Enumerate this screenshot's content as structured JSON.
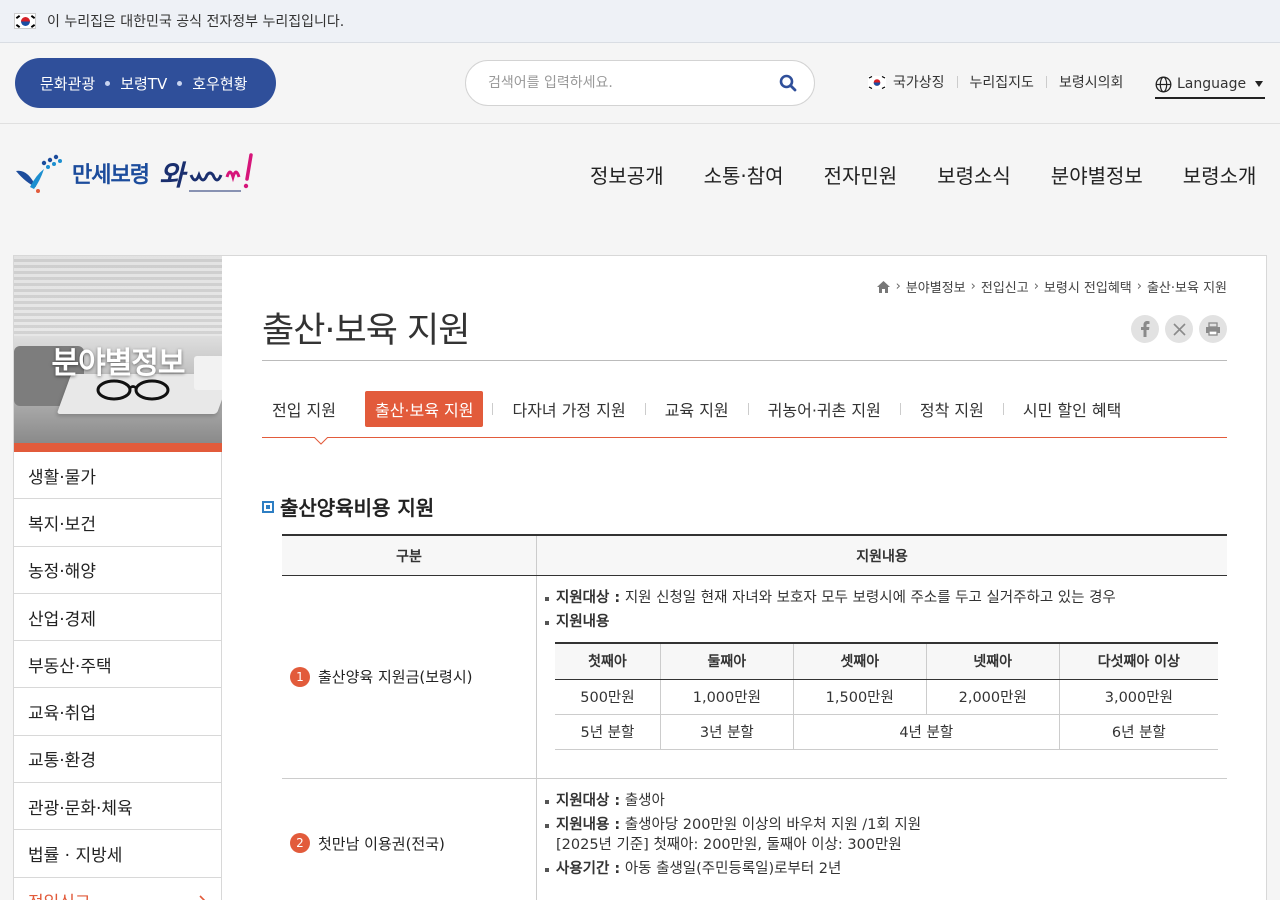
{
  "gov_banner": {
    "text": "이 누리집은 대한민국 공식 전자정부 누리집입니다."
  },
  "quick_links": [
    "문화관광",
    "보령TV",
    "호우현황"
  ],
  "search": {
    "placeholder": "검색어를 입력하세요."
  },
  "top_links": [
    "국가상징",
    "누리집지도",
    "보령시의회"
  ],
  "language": {
    "label": "Language"
  },
  "logo": {
    "city_name": "만세보령",
    "slogan": "와wow!"
  },
  "gnb": [
    "정보공개",
    "소통·참여",
    "전자민원",
    "보령소식",
    "분야별정보",
    "보령소개"
  ],
  "sidebar": {
    "title": "분야별정보",
    "items": [
      "생활·물가",
      "복지·보건",
      "농정·해양",
      "산업·경제",
      "부동산·주택",
      "교육·취업",
      "교통·환경",
      "관광·문화·체육",
      "법률 · 지방세",
      "전입신고"
    ]
  },
  "breadcrumb": [
    "분야별정보",
    "전입신고",
    "보령시 전입혜택",
    "출산·보육 지원"
  ],
  "page_title": "출산·보육 지원",
  "share": [
    "facebook-icon",
    "x-icon",
    "print-icon"
  ],
  "tabs": [
    "전입 지원",
    "출산·보육 지원",
    "다자녀 가정 지원",
    "교육 지원",
    "귀농어·귀촌 지원",
    "정착 지원",
    "시민 할인 혜택"
  ],
  "active_tab": 1,
  "section_title": "출산양육비용 지원",
  "table": {
    "headers": [
      "구분",
      "지원내용"
    ],
    "rows": [
      {
        "num": "1",
        "label": "출산양육 지원금(보령시)",
        "target_label": "지원대상 :",
        "target_text": "지원 신청일 현재 자녀와 보호자 모두 보령시에 주소를 두고 실거주하고 있는 경우",
        "content_label": "지원내용",
        "sub_headers": [
          "첫째아",
          "둘째아",
          "셋째아",
          "넷째아",
          "다섯째아 이상"
        ],
        "amounts": [
          "500만원",
          "1,000만원",
          "1,500만원",
          "2,000만원",
          "3,000만원"
        ],
        "installments": [
          "5년 분할",
          "3년 분할",
          "4년 분할",
          "6년 분할"
        ]
      },
      {
        "num": "2",
        "label": "첫만남 이용권(전국)",
        "target_label": "지원대상 :",
        "target_text": "출생아",
        "content_label": "지원내용 :",
        "content_text": "출생아당 200만원 이상의 바우처 지원 /1회 지원",
        "content_text2": "[2025년 기준] 첫째아: 200만원, 둘째아 이상: 300만원",
        "period_label": "사용기간 :",
        "period_text": "아동 출생일(주민등록일)로부터 2년"
      }
    ]
  }
}
